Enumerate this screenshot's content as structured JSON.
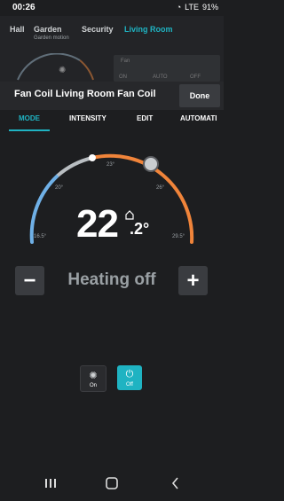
{
  "status_bar": {
    "time": "00:26",
    "battery": "91%",
    "signal": "LTE"
  },
  "background": {
    "tabs": [
      {
        "label": "Hall",
        "sub": ""
      },
      {
        "label": "Garden",
        "sub": "Garden motion"
      },
      {
        "label": "Security",
        "sub": ""
      },
      {
        "label": "Living Room",
        "sub": "",
        "active": true
      }
    ],
    "card_label": "Fan",
    "card_on": "ON",
    "card_auto": "AUTO",
    "card_off": "OFF"
  },
  "header": {
    "title": "Fan Coil Living Room Fan Coil",
    "done_label": "Done"
  },
  "tabs": [
    {
      "label": "MODE",
      "active": true
    },
    {
      "label": "INTENSITY",
      "active": false
    },
    {
      "label": "EDIT",
      "active": false
    },
    {
      "label": "AUTOMATI",
      "active": false
    }
  ],
  "dial": {
    "scale_labels": [
      "16.5°",
      "20°",
      "23°",
      "26°",
      "29.5°"
    ],
    "colors": {
      "cold": "#6fb0e6",
      "neutral": "#b9bec2",
      "warm": "#f0843a"
    }
  },
  "temperature": {
    "integer": "22",
    "decimal": ".2°"
  },
  "heating_status": "Heating off",
  "minus_label": "−",
  "plus_label": "+",
  "modes": {
    "on_label": "On",
    "off_label": "Off"
  },
  "accent": "#1fb3c2"
}
